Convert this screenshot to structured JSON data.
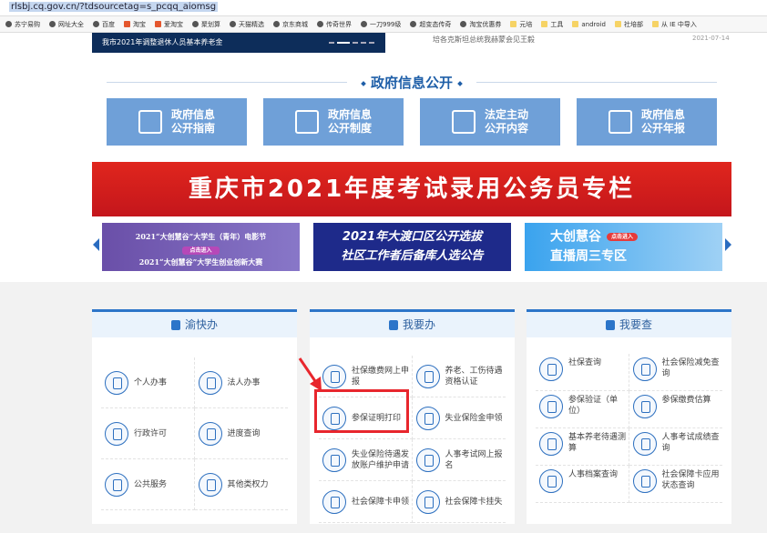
{
  "browser": {
    "url": "rlsbj.cq.gov.cn/?tdsourcetag=s_pcqq_aiomsg",
    "bookmarks": [
      {
        "label": "苏宁易购",
        "icon": "globe"
      },
      {
        "label": "网址大全",
        "icon": "globe"
      },
      {
        "label": "百度",
        "icon": "baidu"
      },
      {
        "label": "淘宝",
        "icon": "taobao"
      },
      {
        "label": "爱淘宝",
        "icon": "taobao"
      },
      {
        "label": "聚划算",
        "icon": "globe"
      },
      {
        "label": "天猫精选",
        "icon": "globe"
      },
      {
        "label": "京东商城",
        "icon": "globe"
      },
      {
        "label": "传奇世界",
        "icon": "globe"
      },
      {
        "label": "一刀999级",
        "icon": "globe"
      },
      {
        "label": "超变态传奇",
        "icon": "globe"
      },
      {
        "label": "淘宝优惠券",
        "icon": "globe"
      },
      {
        "label": "元培",
        "icon": "folder"
      },
      {
        "label": "工具",
        "icon": "folder"
      },
      {
        "label": "android",
        "icon": "folder"
      },
      {
        "label": "社培部",
        "icon": "folder"
      },
      {
        "label": "从 IE 中导入",
        "icon": "folder"
      }
    ]
  },
  "news": {
    "slide_caption": "我市2021年调整退休人员基本养老金",
    "item": "培各克斯坦总统我赫蒙会见王毅",
    "date": "2021-07-14"
  },
  "gov_info": {
    "title": "政府信息公开",
    "items": [
      {
        "line1": "政府信息",
        "line2": "公开指南"
      },
      {
        "line1": "政府信息",
        "line2": "公开制度"
      },
      {
        "line1": "法定主动",
        "line2": "公开内容"
      },
      {
        "line1": "政府信息",
        "line2": "公开年报"
      }
    ]
  },
  "banner": "重庆市2021年度考试录用公务员专栏",
  "carousel": [
    {
      "line1": "2021“大创慧谷”大学生（青年）电影节",
      "button": "点击进入",
      "line2": "2021“大创慧谷”大学生创业创新大赛"
    },
    {
      "line1": "2021年大渡口区公开选拔",
      "line2": "社区工作者后备库人选公告"
    },
    {
      "line1": "大创慧谷",
      "button": "点击进入",
      "line2": "直播周三专区"
    }
  ],
  "panels": [
    {
      "title": "渝快办",
      "items": [
        "个人办事",
        "法人办事",
        "行政许可",
        "进度查询",
        "公共服务",
        "其他类权力"
      ]
    },
    {
      "title": "我要办",
      "items": [
        "社保缴费网上申报",
        "养老、工伤待遇资格认证",
        "参保证明打印",
        "失业保险金申领",
        "失业保险待遇发放账户维护申请",
        "人事考试网上报名",
        "社会保障卡申领",
        "社会保障卡挂失"
      ]
    },
    {
      "title": "我要查",
      "items": [
        "社保查询",
        "社会保险减免查询",
        "参保验证（单位）",
        "参保缴费估算",
        "基本养老待遇测算",
        "人事考试成绩查询",
        "人事档案查询",
        "社会保障卡应用状态查询"
      ]
    }
  ],
  "colors": {
    "accent": "#2c75c9",
    "banner_red": "#d81e1e",
    "highlight": "#e8262d"
  }
}
